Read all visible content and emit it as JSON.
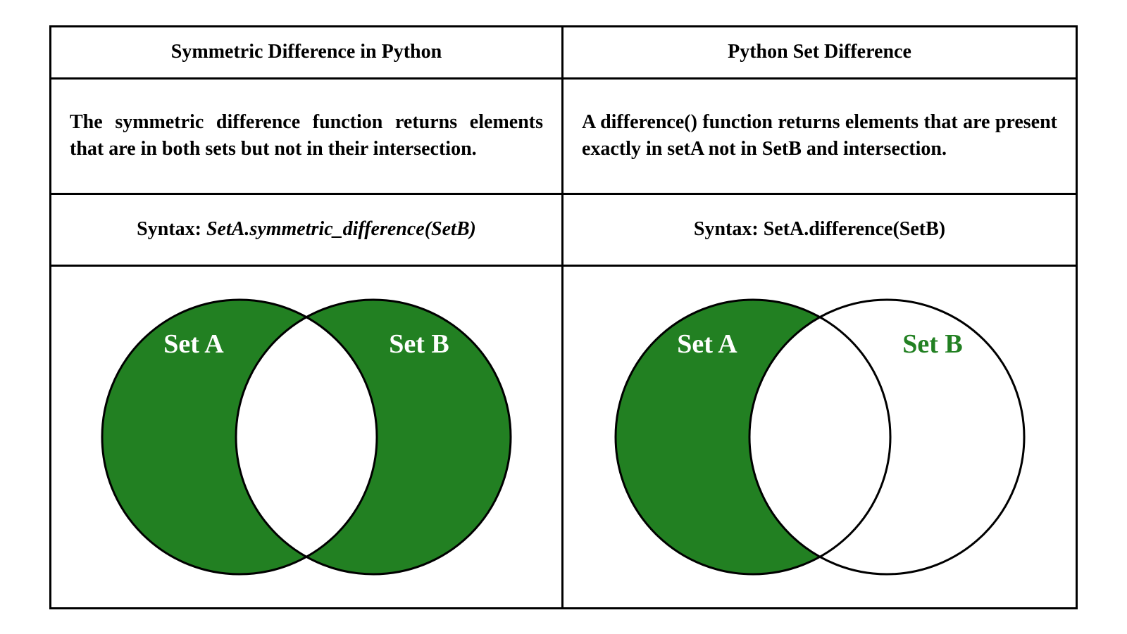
{
  "colors": {
    "green": "#228022",
    "white": "#ffffff",
    "black": "#000000"
  },
  "left": {
    "title": "Symmetric Difference in Python",
    "description": "The symmetric difference function returns elements that are in both sets but not in their intersection.",
    "syntaxPrefix": "Syntax: ",
    "syntaxCode": "SetA.symmetric_difference(SetB)",
    "venn": {
      "setA": "Set A",
      "setB": "Set B"
    }
  },
  "right": {
    "title": "Python Set Difference",
    "description": "A difference() function returns elements that are present exactly in setA not in SetB and intersection.",
    "syntaxPrefix": "Syntax: ",
    "syntaxCode": "SetA.difference(SetB)",
    "venn": {
      "setA": "Set A",
      "setB": "Set B"
    }
  }
}
